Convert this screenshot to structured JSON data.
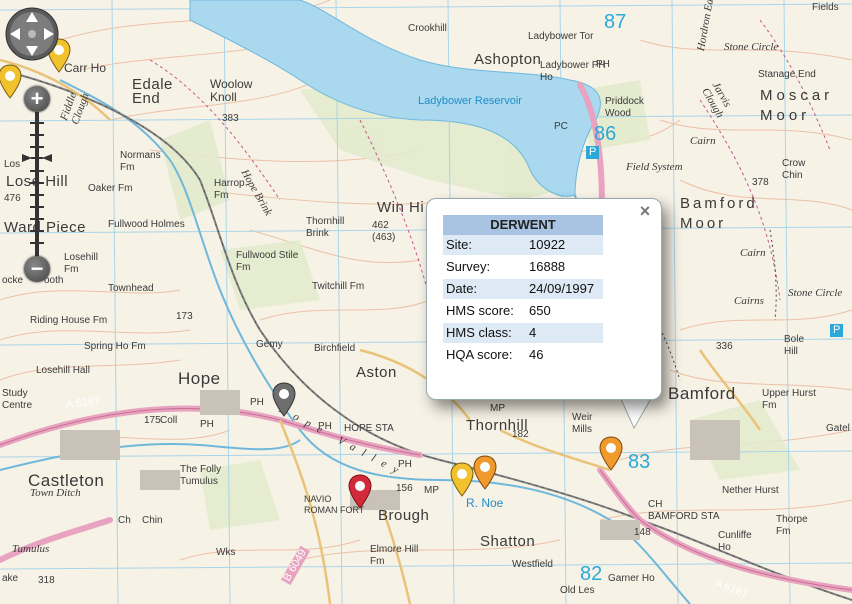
{
  "map": {
    "places": [
      {
        "id": "edale-end",
        "text": "Edale\nEnd"
      },
      {
        "id": "carr-ho",
        "text": "Carr Ho"
      },
      {
        "id": "woolow-knoll",
        "text": "Woolow\nKnoll"
      },
      {
        "id": "crookhill",
        "text": "Crookhill"
      },
      {
        "id": "ashopton",
        "text": "Ashopton"
      },
      {
        "id": "ladybower-tor",
        "text": "Ladybower Tor"
      },
      {
        "id": "ladybower-ph-ho",
        "text": "Ladybower PH\nHo"
      },
      {
        "id": "ladybower-reservoir",
        "text": "Ladybower Reservoir"
      },
      {
        "id": "priddock-wood",
        "text": "Priddock\nWood"
      },
      {
        "id": "stone-circle",
        "text": "Stone Circle"
      },
      {
        "id": "stanage-end",
        "text": "Stanage End"
      },
      {
        "id": "moscar-moor",
        "text": "Moscar\nMoor"
      },
      {
        "id": "fields",
        "text": "Fields"
      },
      {
        "id": "normans-fm",
        "text": "Normans\nFm"
      },
      {
        "id": "oaker-fm",
        "text": "Oaker Fm"
      },
      {
        "id": "harrop-fm",
        "text": "Harrop\nFm"
      },
      {
        "id": "hope-brink",
        "text": "Hope Brink"
      },
      {
        "id": "lose-hill",
        "text": "Lose Hill"
      },
      {
        "id": "ward-piece",
        "text": "Ward Piece"
      },
      {
        "id": "fullwood-holmes",
        "text": "Fullwood Holmes"
      },
      {
        "id": "fullwood-stile-fm",
        "text": "Fullwood Stile\nFm"
      },
      {
        "id": "thornhill-brink",
        "text": "Thornhill\nBrink"
      },
      {
        "id": "win-hill",
        "text": "Win Hi"
      },
      {
        "id": "spot-462",
        "text": "462\n(463)"
      },
      {
        "id": "losehill-fm",
        "text": "Losehill\nFm"
      },
      {
        "id": "townhead",
        "text": "Townhead"
      },
      {
        "id": "twitchill-fm",
        "text": "Twitchill Fm"
      },
      {
        "id": "riding-house-fm",
        "text": "Riding House Fm"
      },
      {
        "id": "spring-ho-fm",
        "text": "Spring Ho Fm"
      },
      {
        "id": "birchfield",
        "text": "Birchfield"
      },
      {
        "id": "aston",
        "text": "Aston"
      },
      {
        "id": "losehill-hall",
        "text": "Losehill Hall"
      },
      {
        "id": "hope",
        "text": "Hope"
      },
      {
        "id": "study-centre",
        "text": "Study\nCentre"
      },
      {
        "id": "hope-sta",
        "text": "HOPE STA"
      },
      {
        "id": "thornhill",
        "text": "Thornhill"
      },
      {
        "id": "bamford",
        "text": "Bamford"
      },
      {
        "id": "weir-mills",
        "text": "Weir\nMills"
      },
      {
        "id": "castleton",
        "text": "Castleton"
      },
      {
        "id": "town-ditch",
        "text": "Town Ditch"
      },
      {
        "id": "the-folly",
        "text": "The Folly\nTumulus"
      },
      {
        "id": "navio",
        "text": "NAVIO\nROMAN FORT"
      },
      {
        "id": "brough",
        "text": "Brough"
      },
      {
        "id": "elmore-hill-fm",
        "text": "Elmore Hill\nFm"
      },
      {
        "id": "shatton",
        "text": "Shatton"
      },
      {
        "id": "westfield",
        "text": "Westfield"
      },
      {
        "id": "garner-ho",
        "text": "Garner Ho"
      },
      {
        "id": "bamford-sta",
        "text": "BAMFORD STA"
      },
      {
        "id": "nether-hurst",
        "text": "Nether Hurst"
      },
      {
        "id": "cunliffe-ho",
        "text": "Cunliffe\nHo"
      },
      {
        "id": "thorpe-fm",
        "text": "Thorpe\nFm"
      },
      {
        "id": "bole-hill",
        "text": "Bole\nHill"
      },
      {
        "id": "upper-hurst-fm",
        "text": "Upper Hurst\nFm"
      },
      {
        "id": "bamford-moor",
        "text": "Bamford\nMoor"
      },
      {
        "id": "crow-chin",
        "text": "Crow\nChin"
      },
      {
        "id": "field-system",
        "text": "Field System"
      },
      {
        "id": "cairns",
        "text": "Cairns"
      },
      {
        "id": "cairn-1",
        "text": "Cairn"
      },
      {
        "id": "cairn-2",
        "text": "Cairn"
      },
      {
        "id": "stone-circle-2",
        "text": "Stone Circle"
      },
      {
        "id": "tumulus",
        "text": "Tumulus"
      },
      {
        "id": "r-noe",
        "text": "R. Noe"
      },
      {
        "id": "hope-valley",
        "text": "Hope Valley"
      },
      {
        "id": "a6187-w",
        "text": "A 6187"
      },
      {
        "id": "a6187-e",
        "text": "A 6187"
      },
      {
        "id": "b6049",
        "text": "B 6049"
      },
      {
        "id": "coll",
        "text": "Coll"
      },
      {
        "id": "old-les",
        "text": "Old Les"
      },
      {
        "id": "gatel",
        "text": "Gatel"
      },
      {
        "id": "chin",
        "text": "Chin"
      },
      {
        "id": "spot-383",
        "text": "383"
      },
      {
        "id": "spot-173",
        "text": "173"
      },
      {
        "id": "spot-175",
        "text": "175"
      },
      {
        "id": "spot-336",
        "text": "336"
      },
      {
        "id": "spot-378",
        "text": "378"
      },
      {
        "id": "spot-318",
        "text": "318"
      },
      {
        "id": "spot-156",
        "text": "156"
      },
      {
        "id": "spot-182",
        "text": "182"
      },
      {
        "id": "spot-148",
        "text": "148"
      },
      {
        "id": "spot-476",
        "text": "476"
      },
      {
        "id": "ph-1",
        "text": "PH"
      },
      {
        "id": "ph-2",
        "text": "PH"
      },
      {
        "id": "ph-3",
        "text": "PH"
      },
      {
        "id": "ph-4",
        "text": "PH"
      },
      {
        "id": "ph-5",
        "text": "PH"
      },
      {
        "id": "mp-1",
        "text": "MP"
      },
      {
        "id": "mp-2",
        "text": "MP"
      },
      {
        "id": "pc",
        "text": "PC"
      },
      {
        "id": "ch-1",
        "text": "CH"
      },
      {
        "id": "ch-2",
        "text": "Ch"
      },
      {
        "id": "wks",
        "text": "Wks"
      },
      {
        "id": "gemy",
        "text": "Gemy"
      },
      {
        "id": "p-1",
        "text": "P"
      },
      {
        "id": "p-2",
        "text": "P"
      },
      {
        "id": "ake",
        "text": "ake"
      },
      {
        "id": "ecke",
        "text": "ocke"
      },
      {
        "id": "ooth",
        "text": "ooth"
      },
      {
        "id": "los",
        "text": "Los"
      },
      {
        "id": "fiddle-clough",
        "text": "Fiddle\nClough"
      },
      {
        "id": "jarvis-clough",
        "text": "Jarvis\nClough"
      },
      {
        "id": "hordron",
        "text": "Hordron Ed"
      }
    ],
    "grid_numbers": [
      "87",
      "86",
      "83",
      "82"
    ],
    "colors": {
      "water": "#a9d7ef",
      "road_a": "#e9a6c0",
      "woodland": "#e4ecd0",
      "contour": "#e9b9a0",
      "grid": "#9fd1ea"
    }
  },
  "controls": {
    "pan_icon": "pan-arrows-icon",
    "zoom_in_label": "+",
    "zoom_out_label": "−",
    "zoom_level_ticks": 16
  },
  "popup": {
    "title": "DERWENT",
    "close_label": "×",
    "rows": [
      {
        "key": "Site:",
        "value": "10922"
      },
      {
        "key": "Survey:",
        "value": "16888"
      },
      {
        "key": "Date:",
        "value": "24/09/1997"
      },
      {
        "key": "HMS score:",
        "value": "650"
      },
      {
        "key": "HMS class:",
        "value": "4"
      },
      {
        "key": "HQA score:",
        "value": "46"
      }
    ]
  },
  "markers": [
    {
      "id": "marker-yellow-nw-1",
      "color": "#f2c12e"
    },
    {
      "id": "marker-yellow-nw-2",
      "color": "#f2c12e"
    },
    {
      "id": "marker-grey-hope",
      "color": "#6e6e6e"
    },
    {
      "id": "marker-red-brough",
      "color": "#d22a3a"
    },
    {
      "id": "marker-yellow-noe",
      "color": "#f2c12e"
    },
    {
      "id": "marker-orange-noe",
      "color": "#ef9a2a"
    },
    {
      "id": "marker-orange-bamford",
      "color": "#ef9a2a"
    }
  ]
}
